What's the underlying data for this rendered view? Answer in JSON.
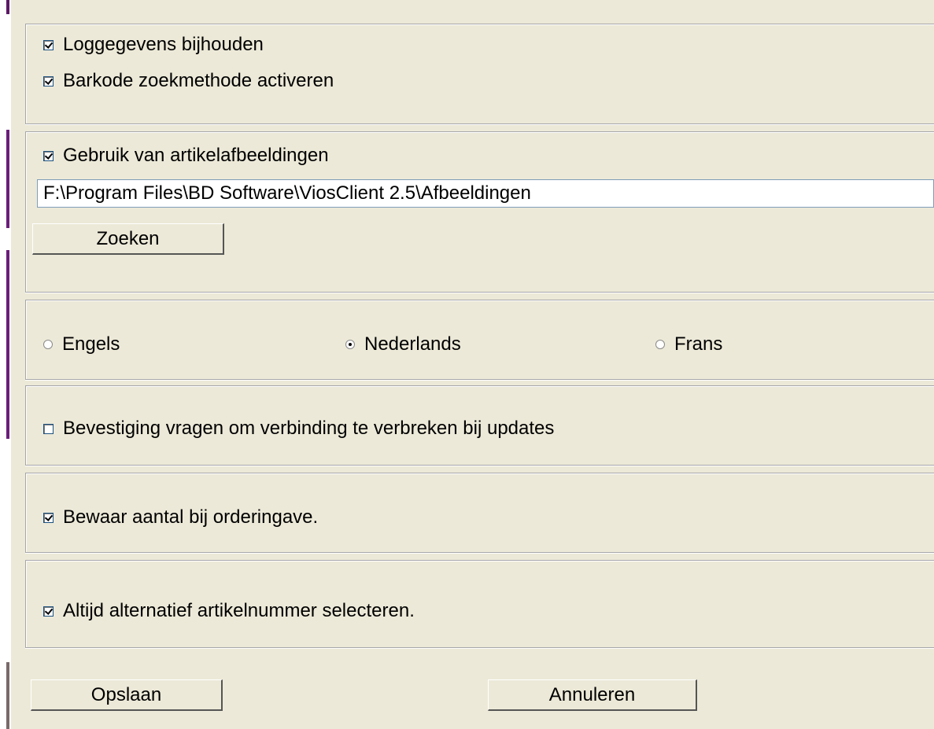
{
  "options": {
    "log": {
      "label": "Loggegevens bijhouden",
      "checked": true
    },
    "barcode": {
      "label": "Barkode zoekmethode activeren",
      "checked": true
    }
  },
  "images": {
    "use": {
      "label": "Gebruik van artikelafbeeldingen",
      "checked": true
    },
    "path": "F:\\Program Files\\BD Software\\ViosClient 2.5\\Afbeeldingen",
    "search_label": "Zoeken"
  },
  "language": {
    "options": [
      {
        "label": "Engels",
        "selected": false
      },
      {
        "label": "Nederlands",
        "selected": true
      },
      {
        "label": "Frans",
        "selected": false
      }
    ]
  },
  "confirm": {
    "label": "Bevestiging vragen om verbinding te verbreken bij updates",
    "checked": false
  },
  "keep_qty": {
    "label": "Bewaar aantal bij orderingave.",
    "checked": true
  },
  "alt_article": {
    "label": "Altijd alternatief artikelnummer selecteren.",
    "checked": true
  },
  "buttons": {
    "save_label": "Opslaan",
    "cancel_label": "Annuleren"
  }
}
